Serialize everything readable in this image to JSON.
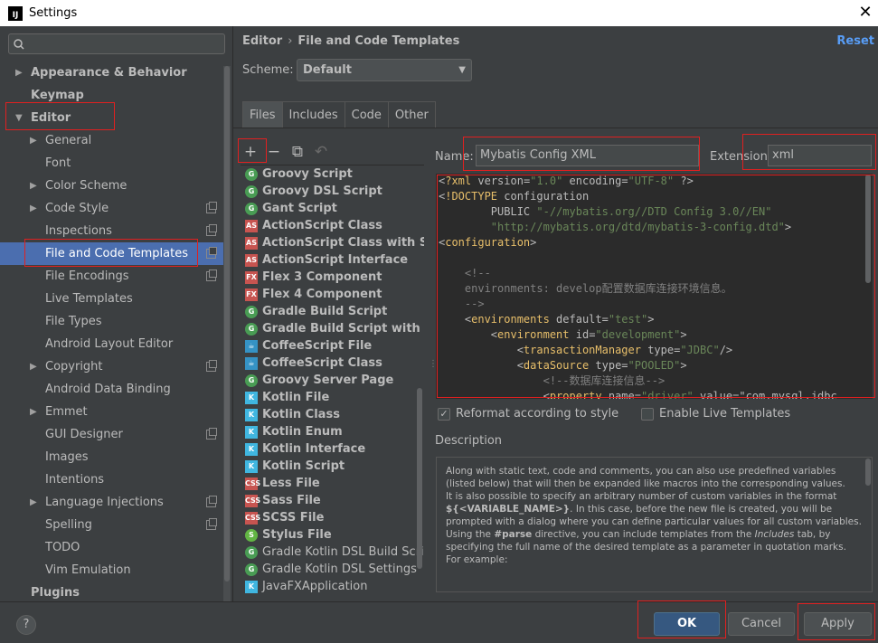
{
  "window": {
    "title": "Settings"
  },
  "search": {
    "placeholder": ""
  },
  "sidebar": {
    "items": [
      {
        "label": "Appearance & Behavior",
        "level": 0,
        "arrow": "▶",
        "bold": true
      },
      {
        "label": "Keymap",
        "level": 0,
        "arrow": "",
        "bold": true
      },
      {
        "label": "Editor",
        "level": 0,
        "arrow": "▼",
        "bold": true
      },
      {
        "label": "General",
        "level": 1,
        "arrow": "▶"
      },
      {
        "label": "Font",
        "level": 1,
        "arrow": ""
      },
      {
        "label": "Color Scheme",
        "level": 1,
        "arrow": "▶"
      },
      {
        "label": "Code Style",
        "level": 1,
        "arrow": "▶",
        "proj": true
      },
      {
        "label": "Inspections",
        "level": 1,
        "arrow": "",
        "proj": true
      },
      {
        "label": "File and Code Templates",
        "level": 1,
        "arrow": "",
        "proj": true,
        "selected": true
      },
      {
        "label": "File Encodings",
        "level": 1,
        "arrow": "",
        "proj": true
      },
      {
        "label": "Live Templates",
        "level": 1,
        "arrow": ""
      },
      {
        "label": "File Types",
        "level": 1,
        "arrow": ""
      },
      {
        "label": "Android Layout Editor",
        "level": 1,
        "arrow": ""
      },
      {
        "label": "Copyright",
        "level": 1,
        "arrow": "▶",
        "proj": true
      },
      {
        "label": "Android Data Binding",
        "level": 1,
        "arrow": ""
      },
      {
        "label": "Emmet",
        "level": 1,
        "arrow": "▶"
      },
      {
        "label": "GUI Designer",
        "level": 1,
        "arrow": "",
        "proj": true
      },
      {
        "label": "Images",
        "level": 1,
        "arrow": ""
      },
      {
        "label": "Intentions",
        "level": 1,
        "arrow": ""
      },
      {
        "label": "Language Injections",
        "level": 1,
        "arrow": "▶",
        "proj": true
      },
      {
        "label": "Spelling",
        "level": 1,
        "arrow": "",
        "proj": true
      },
      {
        "label": "TODO",
        "level": 1,
        "arrow": ""
      },
      {
        "label": "Vim Emulation",
        "level": 1,
        "arrow": ""
      },
      {
        "label": "Plugins",
        "level": 0,
        "arrow": "",
        "bold": true
      }
    ]
  },
  "breadcrumb": {
    "part1": "Editor",
    "sep": "›",
    "part2": "File and Code Templates"
  },
  "reset_label": "Reset",
  "scheme": {
    "label": "Scheme:",
    "value": "Default"
  },
  "tabs": [
    "Files",
    "Includes",
    "Code",
    "Other"
  ],
  "toolbar": {
    "add": "+",
    "remove": "−",
    "copy": "⧉",
    "reset": "↶"
  },
  "templates": [
    {
      "label": "Groovy Script",
      "icon": "g"
    },
    {
      "label": "Groovy DSL Script",
      "icon": "g"
    },
    {
      "label": "Gant Script",
      "icon": "g"
    },
    {
      "label": "ActionScript Class",
      "icon": "as"
    },
    {
      "label": "ActionScript Class with Super",
      "icon": "as"
    },
    {
      "label": "ActionScript Interface",
      "icon": "as"
    },
    {
      "label": "Flex 3 Component",
      "icon": "fx"
    },
    {
      "label": "Flex 4 Component",
      "icon": "fx"
    },
    {
      "label": "Gradle Build Script",
      "icon": "g"
    },
    {
      "label": "Gradle Build Script with wrap",
      "icon": "g"
    },
    {
      "label": "CoffeeScript File",
      "icon": "cf"
    },
    {
      "label": "CoffeeScript Class",
      "icon": "cf"
    },
    {
      "label": "Groovy Server Page",
      "icon": "g"
    },
    {
      "label": "Kotlin File",
      "icon": "kt"
    },
    {
      "label": "Kotlin Class",
      "icon": "kt"
    },
    {
      "label": "Kotlin Enum",
      "icon": "kt"
    },
    {
      "label": "Kotlin Interface",
      "icon": "kt"
    },
    {
      "label": "Kotlin Script",
      "icon": "kt"
    },
    {
      "label": "Less File",
      "icon": "le"
    },
    {
      "label": "Sass File",
      "icon": "le"
    },
    {
      "label": "SCSS File",
      "icon": "le"
    },
    {
      "label": "Stylus File",
      "icon": "st"
    },
    {
      "label": "Gradle Kotlin DSL Build Script",
      "icon": "g",
      "normal": true
    },
    {
      "label": "Gradle Kotlin DSL Settings",
      "icon": "g",
      "normal": true
    },
    {
      "label": "JavaFXApplication",
      "icon": "kt",
      "normal": true
    }
  ],
  "name_field": {
    "label": "Name:",
    "value": "Mybatis Config XML"
  },
  "extension_field": {
    "label": "Extension:",
    "value": "xml"
  },
  "code_lines": [
    "<?xml version=\"1.0\" encoding=\"UTF-8\" ?>",
    "<!DOCTYPE configuration",
    "        PUBLIC \"-//mybatis.org//DTD Config 3.0//EN\"",
    "        \"http://mybatis.org/dtd/mybatis-3-config.dtd\">",
    "<configuration>",
    "",
    "    <!--",
    "    environments: develop配置数据库连接环境信息。",
    "    -->",
    "    <environments default=\"test\">",
    "        <environment id=\"development\">",
    "            <transactionManager type=\"JDBC\"/>",
    "            <dataSource type=\"POOLED\">",
    "                <!--数据库连接信息-->",
    "                <property name=\"driver\" value=\"com.mysql.jdbc"
  ],
  "reformat": {
    "label": "Reformat according to style",
    "checked": true
  },
  "live_templates": {
    "label": "Enable Live Templates",
    "checked": false
  },
  "description": {
    "label": "Description",
    "p1": "Along with static text, code and comments, you can also use predefined variables (listed below) that will then be expanded like macros into the corresponding values.",
    "p2a": "It is also possible to specify an arbitrary number of custom variables in the format ",
    "p2b": "${<VARIABLE_NAME>}",
    "p2c": ". In this case, before the new file is created, you will be prompted with a dialog where you can define particular values for all custom variables.",
    "p3a": "Using the ",
    "p3b": "#parse",
    "p3c": " directive, you can include templates from the ",
    "p3d": "Includes",
    "p3e": " tab, by specifying the full name of the desired template as a parameter in quotation marks. For example:"
  },
  "buttons": {
    "help": "?",
    "ok": "OK",
    "cancel": "Cancel",
    "apply": "Apply"
  },
  "colors": {
    "selection": "#4b6eaf",
    "background": "#3c3f41",
    "editor_bg": "#2b2b2b",
    "highlight": "#e02020",
    "link": "#589df6"
  }
}
